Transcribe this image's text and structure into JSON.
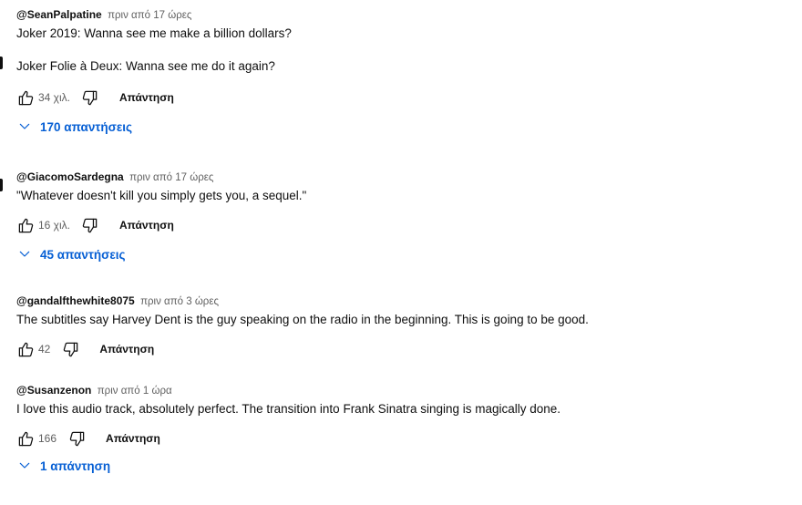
{
  "comments": [
    {
      "author": "@SeanPalpatine",
      "time": "πριν από 17 ώρες",
      "text": "Joker 2019: Wanna see me make a billion dollars?",
      "text2": "Joker Folie à Deux: Wanna see me do it again?",
      "likes": "34 χιλ.",
      "reply_label": "Απάντηση",
      "replies_label": "170 απαντήσεις"
    },
    {
      "author": "@GiacomoSardegna",
      "time": "πριν από 17 ώρες",
      "text": "\"Whatever doesn't kill you simply gets you, a sequel.\"",
      "likes": "16 χιλ.",
      "reply_label": "Απάντηση",
      "replies_label": "45 απαντήσεις"
    },
    {
      "author": "@gandalfthewhite8075",
      "time": "πριν από 3 ώρες",
      "text": "The subtitles say Harvey Dent is the guy speaking on the radio in the beginning. This is going to be good.",
      "likes": "42",
      "reply_label": "Απάντηση"
    },
    {
      "author": "@Susanzenon",
      "time": "πριν από 1 ώρα",
      "text": "I love this audio track, absolutely perfect. The transition into Frank Sinatra singing is magically done.",
      "likes": "166",
      "reply_label": "Απάντηση",
      "replies_label": "1 απάντηση"
    }
  ],
  "colors": {
    "text_primary": "#0f0f0f",
    "text_secondary": "#606060",
    "link_blue": "#065fd4"
  },
  "icons": {
    "like": "thumbs-up-icon",
    "dislike": "thumbs-down-icon",
    "expand": "chevron-down-icon"
  }
}
